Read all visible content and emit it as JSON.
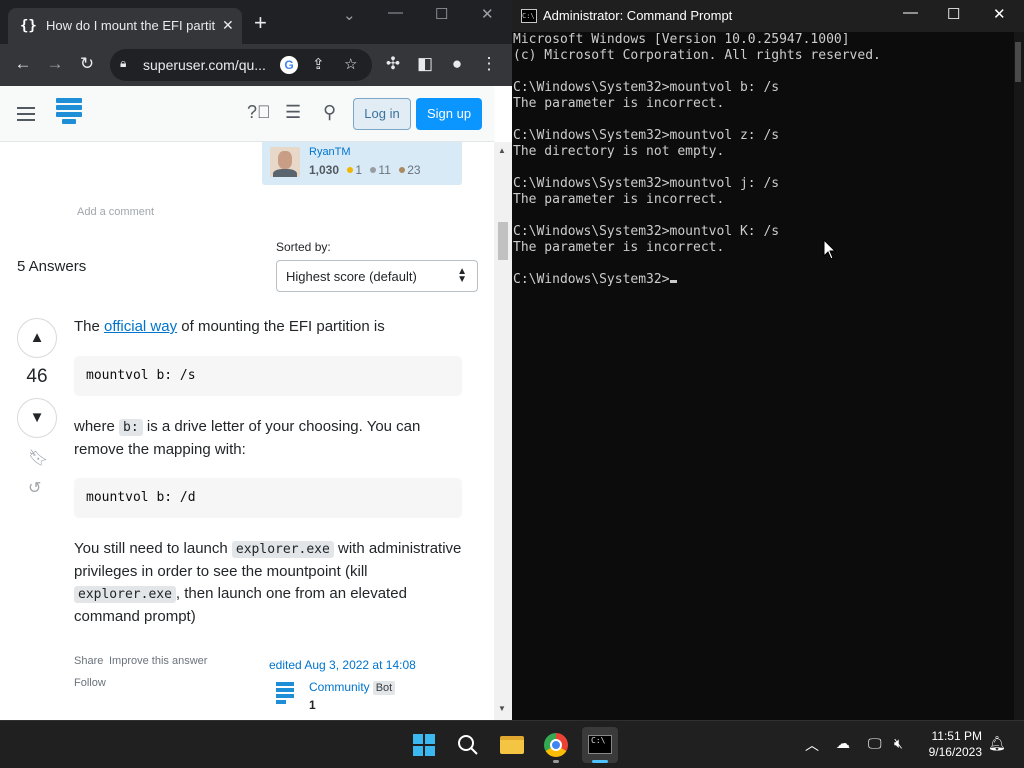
{
  "browser": {
    "tab_title": "How do I mount the EFI partitio",
    "tab_favicon": "{}",
    "url": "superuser.com/qu...",
    "toolbar_icons": [
      "back-arrow-icon",
      "forward-arrow-icon",
      "reload-icon",
      "lock-icon",
      "google-icon",
      "share-icon",
      "star-icon",
      "extensions-icon",
      "side-panel-icon",
      "profile-icon",
      "menu-dots-icon"
    ]
  },
  "site_header": {
    "login_label": "Log in",
    "signup_label": "Sign up"
  },
  "question_owner": {
    "name": "RyanTM",
    "reputation": "1,030",
    "gold": "1",
    "silver": "11",
    "bronze": "23"
  },
  "add_comment": "Add a comment",
  "answers": {
    "count_label": "5 Answers",
    "sort_label": "Sorted by:",
    "sort_value": "Highest score (default)"
  },
  "answer": {
    "score": "46",
    "p1_before": "The ",
    "p1_link": "official way",
    "p1_after": " of mounting the EFI partition is",
    "code1": "mountvol b: /s",
    "p2_before": "where ",
    "p2_code": "b:",
    "p2_after": " is a drive letter of your choosing. You can remove the mapping with:",
    "code2": "mountvol b: /d",
    "p3_before": "You still need to launch ",
    "p3_code1": "explorer.exe",
    "p3_mid": " with administrative privileges in order to see the mountpoint (kill ",
    "p3_code2": "explorer.exe",
    "p3_after": ", then launch one from an elevated command prompt)",
    "share": "Share",
    "improve": "Improve this answer",
    "follow": "Follow",
    "edited": "edited Aug 3, 2022 at 14:08",
    "editor_name": "Community",
    "editor_badge": "Bot",
    "editor_rep": "1"
  },
  "cmd": {
    "title": "Administrator: Command Prompt",
    "lines": [
      "Microsoft Windows [Version 10.0.25947.1000]",
      "(c) Microsoft Corporation. All rights reserved.",
      "",
      "C:\\Windows\\System32>mountvol b: /s",
      "The parameter is incorrect.",
      "",
      "C:\\Windows\\System32>mountvol z: /s",
      "The directory is not empty.",
      "",
      "C:\\Windows\\System32>mountvol j: /s",
      "The parameter is incorrect.",
      "",
      "C:\\Windows\\System32>mountvol K: /s",
      "The parameter is incorrect.",
      ""
    ],
    "prompt": "C:\\Windows\\System32>"
  },
  "taskbar": {
    "time": "11:51 PM",
    "date": "9/16/2023"
  },
  "colors": {
    "accent": "#0a95ff",
    "link": "#0074cc",
    "terminal_bg": "#0c0c0c",
    "terminal_fg": "#cccccc",
    "taskbar_bg": "#202020"
  }
}
